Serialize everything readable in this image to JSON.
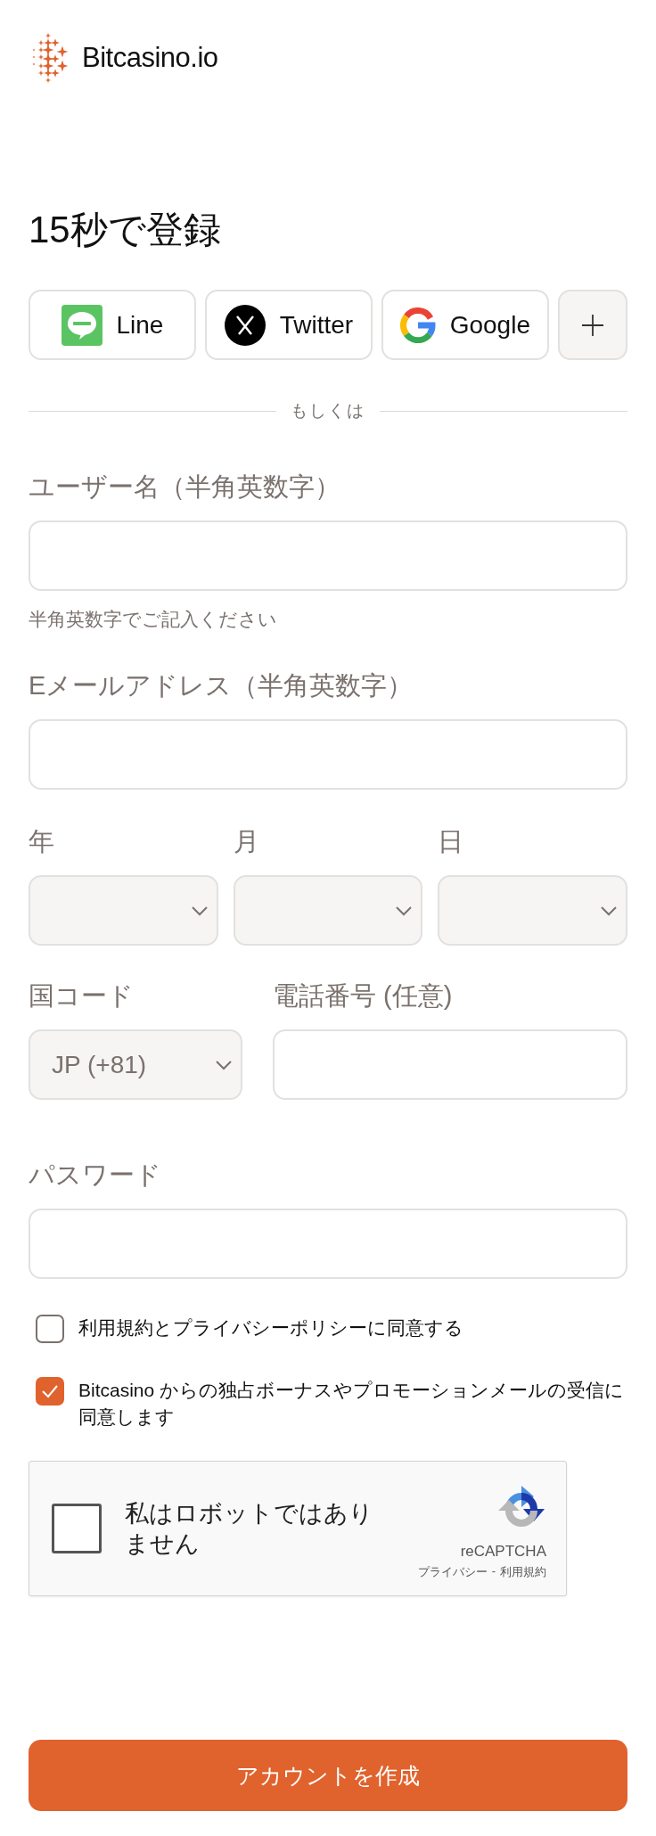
{
  "logo": {
    "text": "Bitcasino.io"
  },
  "title": "15秒で登録",
  "social_buttons": [
    {
      "kind": "line",
      "label": "Line"
    },
    {
      "kind": "twitter",
      "label": "Twitter"
    },
    {
      "kind": "google",
      "label": "Google"
    },
    {
      "kind": "more"
    }
  ],
  "divider": "もしくは",
  "username": {
    "label": "ユーザー名（半角英数字）",
    "hint": "半角英数字でご記入ください"
  },
  "email": {
    "label": "Eメールアドレス（半角英数字）"
  },
  "birthdate": [
    {
      "label": "年"
    },
    {
      "label": "月"
    },
    {
      "label": "日"
    }
  ],
  "country_code": {
    "label": "国コード",
    "value": "JP (+81)"
  },
  "phone": {
    "label": "電話番号 (任意)"
  },
  "password": {
    "label": "パスワード"
  },
  "checkboxes": [
    {
      "label": "利用規約とプライバシーポリシーに同意する",
      "checked": false
    },
    {
      "label": "Bitcasino からの独占ボーナスやプロモーションメールの受信に同意します",
      "checked": true
    }
  ],
  "recaptcha": {
    "label": "私はロボットではありません",
    "checked": false,
    "brand": "reCAPTCHA",
    "privacy": "プライバシー",
    "separator": "-",
    "terms": "利用規約"
  },
  "submit": "アカウントを作成"
}
